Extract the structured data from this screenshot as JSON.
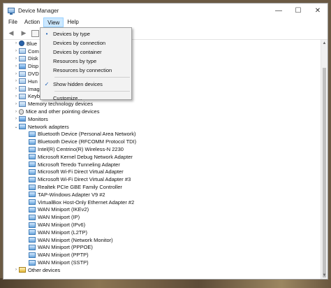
{
  "window": {
    "title": "Device Manager",
    "controls": {
      "minimize": "—",
      "maximize": "☐",
      "close": "✕"
    }
  },
  "menubar": {
    "items": [
      "File",
      "Action",
      "View",
      "Help"
    ]
  },
  "toolbar": {
    "back": "◀",
    "forward": "▶"
  },
  "tree": {
    "top_items": [
      {
        "label": "Blue",
        "icon": "bluetooth-icon",
        "expander": "›"
      },
      {
        "label": "Com",
        "icon": "computer-icon",
        "expander": "›"
      },
      {
        "label": "Disk",
        "icon": "disk-icon",
        "expander": "›"
      },
      {
        "label": "Disp",
        "icon": "display-icon",
        "expander": "›"
      },
      {
        "label": "DVD",
        "icon": "dvd-icon",
        "expander": "›"
      },
      {
        "label": "Hun",
        "icon": "hid-icon",
        "expander": "›"
      },
      {
        "label": "Imag",
        "icon": "imaging-icon",
        "expander": "›"
      },
      {
        "label": "Keyb",
        "icon": "keyboard-icon",
        "expander": "›"
      },
      {
        "label": "Memory technology devices",
        "icon": "memory-icon",
        "expander": "›"
      },
      {
        "label": "Mice and other pointing devices",
        "icon": "mouse-icon",
        "expander": "›"
      },
      {
        "label": "Monitors",
        "icon": "monitor-icon",
        "expander": "›"
      },
      {
        "label": "Network adapters",
        "icon": "network-icon",
        "expander": "⌄"
      }
    ],
    "network_children": [
      "Bluetooth Device (Personal Area Network)",
      "Bluetooth Device (RFCOMM Protocol TDI)",
      "Intel(R) Centrino(R) Wireless-N 2230",
      "Microsoft Kernel Debug Network Adapter",
      "Microsoft Teredo Tunneling Adapter",
      "Microsoft Wi-Fi Direct Virtual Adapter",
      "Microsoft Wi-Fi Direct Virtual Adapter #3",
      "Realtek PCIe GBE Family Controller",
      "TAP-Windows Adapter V9 #2",
      "VirtualBox Host-Only Ethernet Adapter #2",
      "WAN Miniport (IKEv2)",
      "WAN Miniport (IP)",
      "WAN Miniport (IPv6)",
      "WAN Miniport (L2TP)",
      "WAN Miniport (Network Monitor)",
      "WAN Miniport (PPPOE)",
      "WAN Miniport (PPTP)",
      "WAN Miniport (SSTP)"
    ],
    "bottom_items": [
      {
        "label": "Other devices",
        "icon": "warning-icon",
        "expander": "›"
      }
    ]
  },
  "view_menu": {
    "items": [
      {
        "label": "Devices by type",
        "mark": "•"
      },
      {
        "label": "Devices by connection",
        "mark": ""
      },
      {
        "label": "Devices by container",
        "mark": ""
      },
      {
        "label": "Resources by type",
        "mark": ""
      },
      {
        "label": "Resources by connection",
        "mark": ""
      }
    ],
    "toggle_items": [
      {
        "label": "Show hidden devices",
        "mark": "✓"
      }
    ],
    "extra_items": [
      {
        "label": "Customize...",
        "mark": ""
      }
    ]
  },
  "colors": {
    "menu_active_bg": "#cce8ff",
    "accent": "#1a5fb4"
  }
}
